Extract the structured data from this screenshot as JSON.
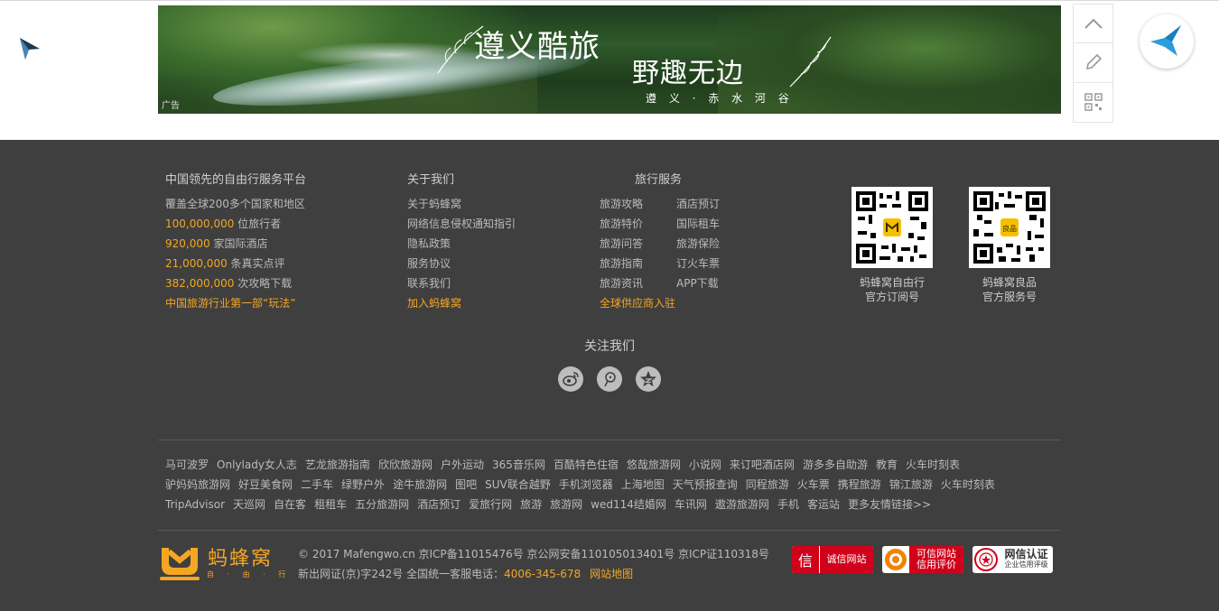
{
  "banner": {
    "title_line1": "遵义酷旅",
    "title_line2": "野趣无边",
    "subtitle": "遵 义 · 赤 水 河 谷",
    "ad_label": "广告"
  },
  "sidebar": {
    "items": [
      "scroll-top-icon",
      "edit-icon",
      "qrcode-icon"
    ]
  },
  "footer": {
    "about_platform": {
      "title": "中国领先的自由行服务平台",
      "line1": "覆盖全球200多个国家和地区",
      "stat1_value": "100,000,000",
      "stat1_label": " 位旅行者",
      "stat2_value": "920,000",
      "stat2_label": " 家国际酒店",
      "stat3_value": "21,000,000",
      "stat3_label": " 条真实点评",
      "stat4_value": "382,000,000",
      "stat4_label": " 次攻略下载",
      "slogan": "中国旅游行业第一部“玩法”"
    },
    "about_us": {
      "title": "关于我们",
      "items": [
        "关于蚂蜂窝",
        "网络信息侵权通知指引",
        "隐私政策",
        "服务协议",
        "联系我们"
      ],
      "join": "加入蚂蜂窝"
    },
    "travel_services": {
      "title": "旅行服务",
      "items": [
        "旅游攻略",
        "酒店预订",
        "旅游特价",
        "国际租车",
        "旅游问答",
        "旅游保险",
        "旅游指南",
        "订火车票",
        "旅游资讯",
        "APP下载"
      ],
      "supplier": "全球供应商入驻"
    },
    "qr_codes": [
      {
        "caption1": "蚂蜂窝自由行",
        "caption2": "官方订阅号"
      },
      {
        "caption1": "蚂蜂窝良品",
        "caption2": "官方服务号"
      }
    ],
    "follow": {
      "title": "关注我们",
      "icons": [
        "weibo-icon",
        "wechat-icon",
        "qzone-icon"
      ]
    },
    "friend_links": [
      [
        "马可波罗",
        "Onlylady女人志",
        "艺龙旅游指南",
        "欣欣旅游网",
        "户外运动",
        "365音乐网",
        "百酷特色住宿",
        "悠哉旅游网",
        "小说网",
        "来订吧酒店网",
        "游多多自助游",
        "教育",
        "火车时刻表"
      ],
      [
        "驴妈妈旅游网",
        "好豆美食网",
        "二手车",
        "绿野户外",
        "途牛旅游网",
        "图吧",
        "SUV联合越野",
        "手机浏览器",
        "上海地图",
        "天气预报查询",
        "同程旅游",
        "火车票",
        "携程旅游",
        "锦江旅游",
        "火车时刻表"
      ],
      [
        "TripAdvisor",
        "天巡网",
        "自在客",
        "租租车",
        "五分旅游网",
        "酒店预订",
        "爱旅行网",
        "旅游",
        "旅游网",
        "wed114结婚网",
        "车讯网",
        "遨游旅游网",
        "手机",
        "客运站",
        "更多友情链接>>"
      ]
    ],
    "logo": {
      "name": "蚂蜂窝",
      "sub": "自 · 由 · 行"
    },
    "copyright": {
      "line1": "© 2017 Mafengwo.cn 京ICP备11015476号 京公网安备110105013401号 京ICP证110318号",
      "line2_prefix": "新出网证(京)字242号 全国统一客服电话：",
      "phone": "4006-345-678",
      "sitemap": "网站地图"
    },
    "badges": [
      {
        "icon": "信",
        "text": "诚信网站"
      },
      {
        "text1": "可信网站",
        "text2": "信用评价"
      },
      {
        "text1": "网信认证",
        "text2": "企业信用评级"
      }
    ]
  },
  "colors": {
    "footer_bg": "#3f3f3f",
    "accent": "#f5a623",
    "text": "#bbbbbb"
  }
}
